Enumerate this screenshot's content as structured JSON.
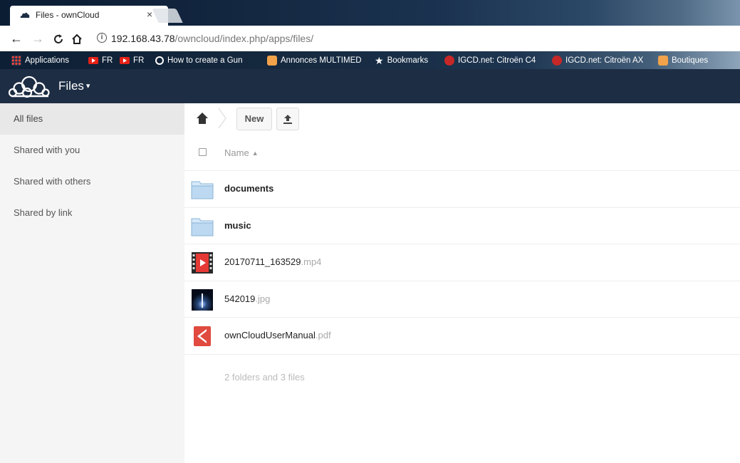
{
  "browser": {
    "tab_title": "Files - ownCloud",
    "tab_close": "×",
    "url_host": "192.168.43.78",
    "url_path": "/owncloud/index.php/apps/files/",
    "bookmarks": [
      {
        "label": "Applications",
        "icon": "apps-grid-icon"
      },
      {
        "label": "FR",
        "icon": "youtube-icon"
      },
      {
        "label": "FR",
        "icon": "youtube-icon"
      },
      {
        "label": "How to create a Gun",
        "icon": "link-icon"
      },
      {
        "label": "Annonces MULTIMED",
        "icon": "box-icon"
      },
      {
        "label": "Bookmarks",
        "icon": "star-icon"
      },
      {
        "label": "IGCD.net: Citroën C4",
        "icon": "igcd-icon"
      },
      {
        "label": "IGCD.net: Citroën AX",
        "icon": "igcd-icon"
      },
      {
        "label": "Boutiques",
        "icon": "box-icon"
      }
    ]
  },
  "header": {
    "app_name": "Files",
    "caret": "▾"
  },
  "sidebar": {
    "items": [
      {
        "label": "All files",
        "active": true
      },
      {
        "label": "Shared with you",
        "active": false
      },
      {
        "label": "Shared with others",
        "active": false
      },
      {
        "label": "Shared by link",
        "active": false
      }
    ]
  },
  "controls": {
    "new_label": "New"
  },
  "list": {
    "name_header": "Name",
    "sort_indicator": "▲",
    "files": [
      {
        "name": "documents",
        "ext": "",
        "type": "folder",
        "icon": "folder-icon"
      },
      {
        "name": "music",
        "ext": "",
        "type": "folder",
        "icon": "folder-icon"
      },
      {
        "name": "20170711_163529",
        "ext": ".mp4",
        "type": "video",
        "icon": "video-file-icon"
      },
      {
        "name": "542019",
        "ext": ".jpg",
        "type": "image",
        "icon": "image-thumbnail"
      },
      {
        "name": "ownCloudUserManual",
        "ext": ".pdf",
        "type": "pdf",
        "icon": "pdf-file-icon"
      }
    ],
    "summary": "2 folders and 3 files"
  },
  "colors": {
    "header_bg": "#1d2d44",
    "sidebar_bg": "#f5f5f5",
    "active_bg": "#e8e8e8"
  }
}
